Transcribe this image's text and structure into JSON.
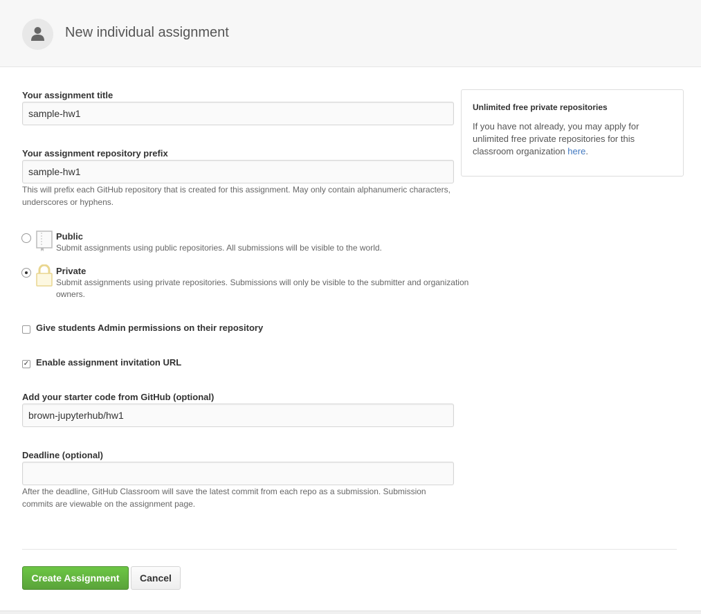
{
  "header": {
    "title": "New individual assignment",
    "icon": "person-icon"
  },
  "form": {
    "title_label": "Your assignment title",
    "title_value": "sample-hw1",
    "prefix_label": "Your assignment repository prefix",
    "prefix_value": "sample-hw1",
    "prefix_note": "This will prefix each GitHub repository that is created for this assignment. May only contain alphanumeric characters, underscores or hyphens.",
    "visibility": {
      "selected": "Private",
      "options": [
        {
          "label": "Public",
          "description": "Submit assignments using public repositories. All submissions will be visible to the world.",
          "icon": "book-icon"
        },
        {
          "label": "Private",
          "description": "Submit assignments using private repositories. Submissions will only be visible to the submitter and organization owners.",
          "icon": "lock-icon"
        }
      ]
    },
    "admin_permissions_label": "Give students Admin permissions on their repository",
    "admin_permissions_checked": false,
    "invitation_url_label": "Enable assignment invitation URL",
    "invitation_url_checked": true,
    "starter_code_label": "Add your starter code from GitHub (optional)",
    "starter_code_value": "brown-jupyterhub/hw1",
    "deadline_label": "Deadline (optional)",
    "deadline_value": "",
    "deadline_note": "After the deadline, GitHub Classroom will save the latest commit from each repo as a submission. Submission commits are viewable on the assignment page."
  },
  "sidebar": {
    "title": "Unlimited free private repositories",
    "body": "If you have not already, you may apply for unlimited free private repositories for this classroom organization",
    "link_text": "here",
    "tail": "."
  },
  "actions": {
    "create_label": "Create Assignment",
    "cancel_label": "Cancel"
  },
  "colors": {
    "primary_green": "#6cc644",
    "link_blue": "#4078c0",
    "lock_yellow": "#e9d68f"
  }
}
